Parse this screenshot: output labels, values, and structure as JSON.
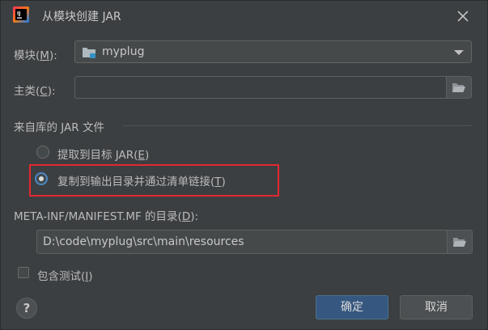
{
  "window": {
    "title": "从模块创建 JAR"
  },
  "module": {
    "label_prefix": "模块(",
    "label_key": "M",
    "label_suffix": "):",
    "value": "myplug"
  },
  "main_class": {
    "label_prefix": "主类(",
    "label_key": "C",
    "label_suffix": "):",
    "value": ""
  },
  "jar_from_libs": {
    "group_label": "来自库的 JAR 文件",
    "options": [
      {
        "prefix": "提取到目标 JAR(",
        "key": "E",
        "suffix": ")",
        "checked": false
      },
      {
        "prefix": "复制到输出目录并通过清单链接(",
        "key": "T",
        "suffix": ")",
        "checked": true
      }
    ]
  },
  "manifest": {
    "label_prefix": "META-INF/MANIFEST.MF 的目录(",
    "label_key": "D",
    "label_suffix": "):",
    "value": "D:\\code\\myplug\\src\\main\\resources"
  },
  "include_tests": {
    "prefix": "包含测试(",
    "key": "I",
    "suffix": ")",
    "checked": false
  },
  "buttons": {
    "help": "?",
    "ok": "确定",
    "cancel": "取消"
  },
  "colors": {
    "background": "#3c3f41",
    "primary_button": "#365880",
    "highlight_box": "#e4282f",
    "radio_accent": "#4a88c7"
  }
}
